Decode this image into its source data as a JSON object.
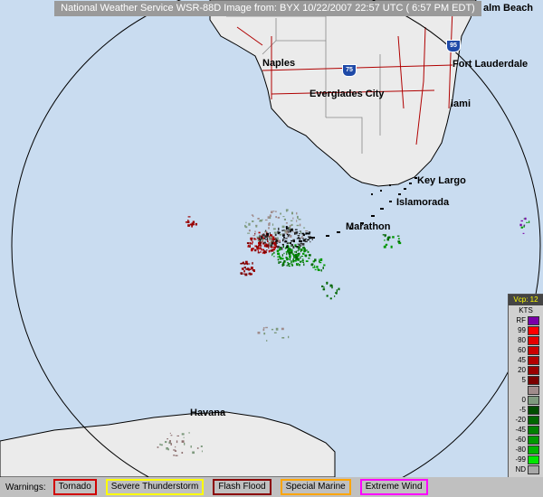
{
  "header": {
    "title": "National Weather Service WSR-88D Image from: BYX 10/22/2007  22:57 UTC ( 6:57 PM EDT)",
    "corner_label": "alm Beach"
  },
  "cities": [
    {
      "name": "Naples"
    },
    {
      "name": "Everglades City"
    },
    {
      "name": "Fort Lauderdale"
    },
    {
      "name": "iami"
    },
    {
      "name": "Key Largo"
    },
    {
      "name": "Islamorada"
    },
    {
      "name": "Marathon"
    },
    {
      "name": "Havana"
    }
  ],
  "highway_shields": [
    {
      "label": "75"
    },
    {
      "label": "95"
    }
  ],
  "legend": {
    "header": "Vcp: 12",
    "unit": "KTS",
    "rows": [
      {
        "label": "RF",
        "color": "#7a00a8"
      },
      {
        "label": "99",
        "color": "#ff0000"
      },
      {
        "label": "80",
        "color": "#e60000"
      },
      {
        "label": "60",
        "color": "#cc0000"
      },
      {
        "label": "45",
        "color": "#b30000"
      },
      {
        "label": "20",
        "color": "#990000"
      },
      {
        "label": "5",
        "color": "#7a0000"
      },
      {
        "label": "",
        "color": "#a08c8c"
      },
      {
        "label": "0",
        "color": "#7e9a7e"
      },
      {
        "label": "-5",
        "color": "#004d00"
      },
      {
        "label": "-20",
        "color": "#006600"
      },
      {
        "label": "-45",
        "color": "#008000"
      },
      {
        "label": "-60",
        "color": "#009900"
      },
      {
        "label": "-80",
        "color": "#00b300"
      },
      {
        "label": "-99",
        "color": "#00e600"
      },
      {
        "label": "ND",
        "color": "#a8a8a8"
      }
    ]
  },
  "warnings": {
    "label": "Warnings:",
    "items": [
      {
        "label": "Tornado",
        "color": "#d00000"
      },
      {
        "label": "Severe Thunderstorm",
        "color": "#ffff00"
      },
      {
        "label": "Flash Flood",
        "color": "#8b0000"
      },
      {
        "label": "Special Marine",
        "color": "#ffa500"
      },
      {
        "label": "Extreme Wind",
        "color": "#ff00ff"
      }
    ]
  },
  "colors": {
    "water": "#c9dcf0",
    "land": "#ebebeb",
    "roads": "#b00000",
    "range_ring": "#000000"
  }
}
